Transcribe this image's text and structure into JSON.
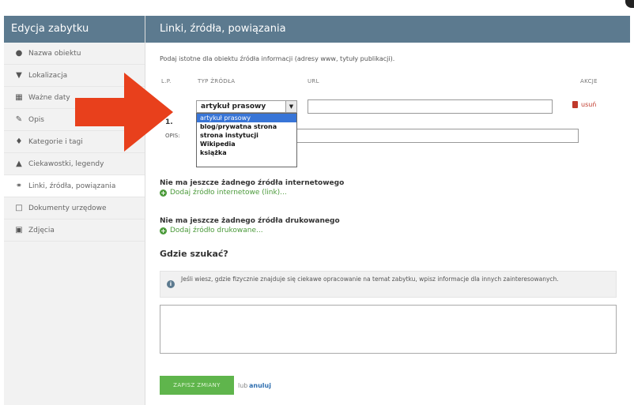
{
  "sidebar": {
    "title": "Edycja zabytku",
    "items": [
      {
        "label": "Nazwa obiektu",
        "icon": "info-circle-icon"
      },
      {
        "label": "Lokalizacja",
        "icon": "map-pin-icon"
      },
      {
        "label": "Ważne daty",
        "icon": "calendar-icon"
      },
      {
        "label": "Opis",
        "icon": "edit-icon"
      },
      {
        "label": "Kategorie i tagi",
        "icon": "tag-icon"
      },
      {
        "label": "Ciekawostki, legendy",
        "icon": "chat-icon"
      },
      {
        "label": "Linki, źródła, powiązania",
        "icon": "link-icon"
      },
      {
        "label": "Dokumenty urzędowe",
        "icon": "document-icon"
      },
      {
        "label": "Zdjęcia",
        "icon": "camera-icon"
      }
    ]
  },
  "main": {
    "title": "Linki, źródła, powiązania",
    "intro": "Podaj istotne dla obiektu źródła informacji (adresy www, tytuły publikacji).",
    "columns": {
      "lp": "L.P.",
      "type": "TYP ŹRÓDŁA",
      "url": "URL",
      "actions": "AKCJE"
    },
    "row": {
      "number": "1.",
      "selected_type": "artykuł prasowy",
      "opis_label": "OPIS:",
      "delete_label": "usuń"
    },
    "dropdown_options": [
      "artykuł prasowy",
      "blog/prywatna strona",
      "strona instytucji",
      "Wikipedia",
      "książka"
    ],
    "internet": {
      "empty": "Nie ma jeszcze żadnego źródła internetowego",
      "add": "Dodaj źródło internetowe (link)..."
    },
    "print": {
      "empty": "Nie ma jeszcze żadnego źródła drukowanego",
      "add": "Dodaj źródło drukowane..."
    },
    "where": {
      "title": "Gdzie szukać?",
      "info": "Jeśli wiesz, gdzie fizycznie znajduje się ciekawe opracowanie na temat zabytku, wpisz informacje dla innych zainteresowanych."
    },
    "save_label": "ZAPISZ ZMIANY",
    "or_label": "lub",
    "cancel_label": "anuluj"
  },
  "colors": {
    "header": "#5c7a8f",
    "save": "#5fb54c",
    "add_link": "#4b9a3a",
    "delete": "#c0392b",
    "arrow": "#e8401c",
    "selected_option": "#3875d7"
  }
}
